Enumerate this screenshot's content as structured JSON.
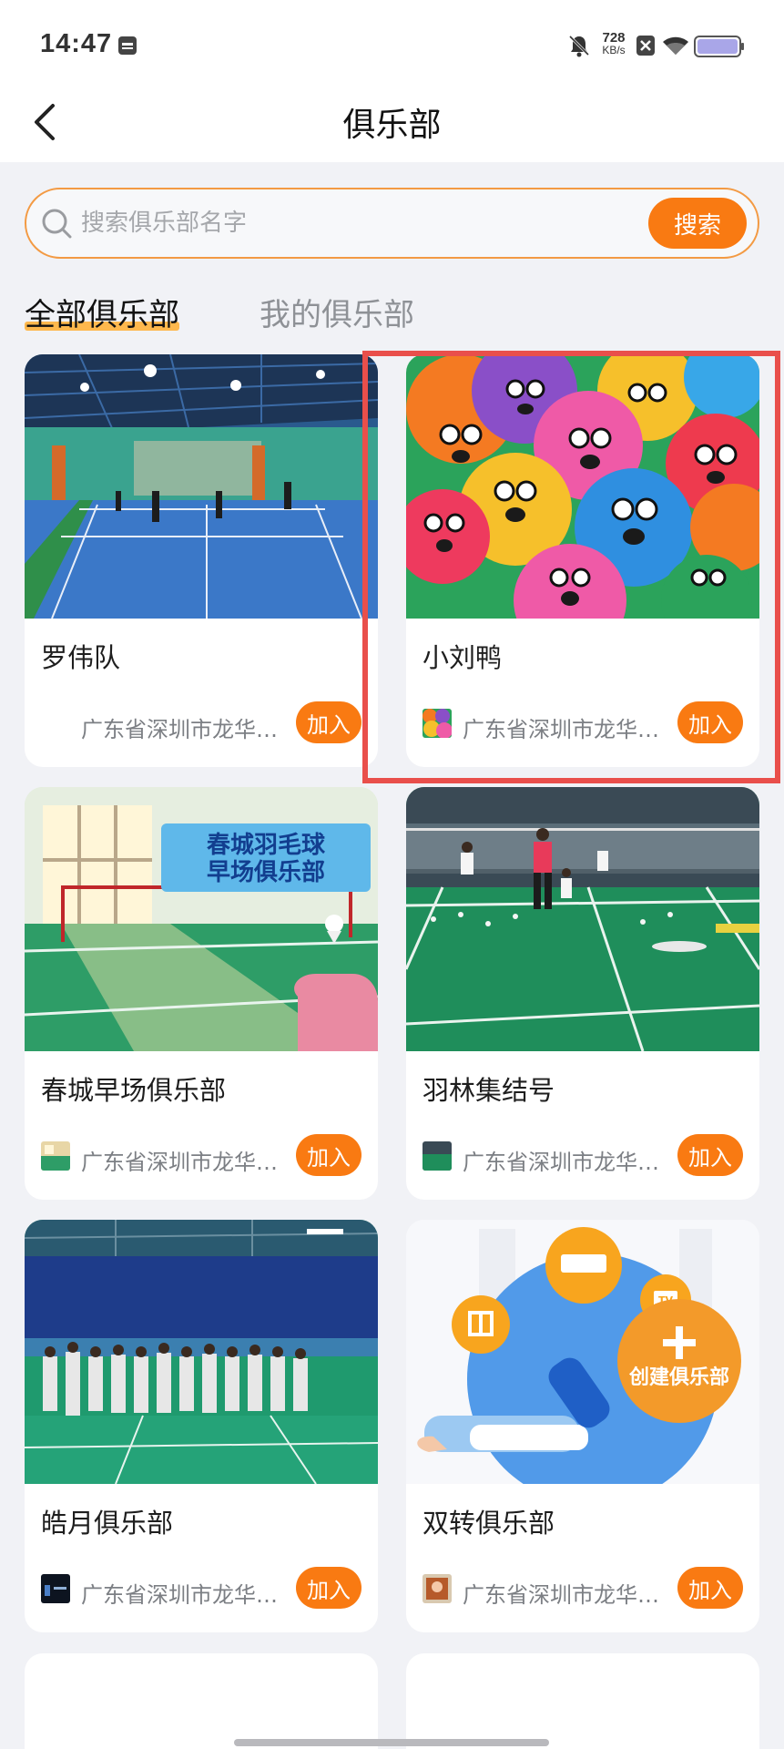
{
  "status_bar": {
    "time": "14:47",
    "net_speed": "728",
    "net_unit": "KB/s"
  },
  "nav": {
    "title": "俱乐部"
  },
  "search": {
    "placeholder": "搜索俱乐部名字",
    "value": "",
    "button_label": "搜索"
  },
  "tabs": [
    {
      "label": "全部俱乐部",
      "active": true
    },
    {
      "label": "我的俱乐部",
      "active": false
    }
  ],
  "clubs": [
    {
      "name": "罗伟队",
      "location": "广东省深圳市龙华…",
      "join_label": "加入"
    },
    {
      "name": "小刘鸭",
      "location": "广东省深圳市龙华…",
      "join_label": "加入"
    },
    {
      "name": "春城早场俱乐部",
      "location": "广东省深圳市龙华…",
      "join_label": "加入"
    },
    {
      "name": "羽林集结号",
      "location": "广东省深圳市龙华…",
      "join_label": "加入"
    },
    {
      "name": "皓月俱乐部",
      "location": "广东省深圳市龙华…",
      "join_label": "加入"
    },
    {
      "name": "双转俱乐部",
      "location": "广东省深圳市龙华…",
      "join_label": "加入"
    }
  ],
  "banner_texts": {
    "chuncheng_line1": "春城羽毛球",
    "chuncheng_line2": "早场俱乐部",
    "create_club": "创建俱乐部",
    "tv": "TV"
  },
  "colors": {
    "accent": "#f97a12",
    "tab_underline": "#ffb13b",
    "highlight": "#e94f4b"
  }
}
